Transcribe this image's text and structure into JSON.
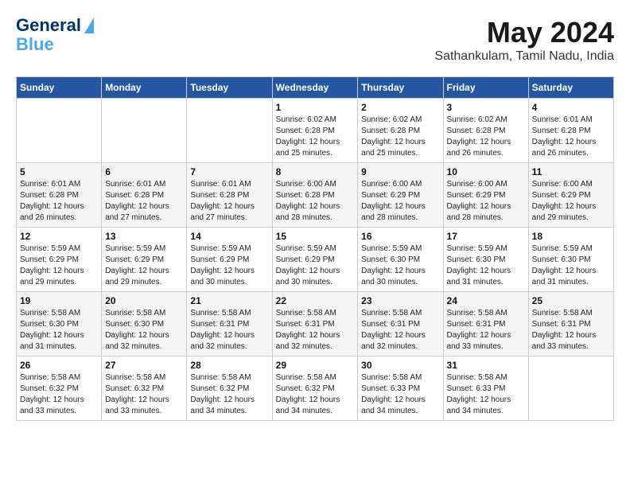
{
  "header": {
    "logo_line1": "General",
    "logo_line2": "Blue",
    "month_year": "May 2024",
    "location": "Sathankulam, Tamil Nadu, India"
  },
  "days_of_week": [
    "Sunday",
    "Monday",
    "Tuesday",
    "Wednesday",
    "Thursday",
    "Friday",
    "Saturday"
  ],
  "weeks": [
    [
      {
        "day": "",
        "info": ""
      },
      {
        "day": "",
        "info": ""
      },
      {
        "day": "",
        "info": ""
      },
      {
        "day": "1",
        "info": "Sunrise: 6:02 AM\nSunset: 6:28 PM\nDaylight: 12 hours\nand 25 minutes."
      },
      {
        "day": "2",
        "info": "Sunrise: 6:02 AM\nSunset: 6:28 PM\nDaylight: 12 hours\nand 25 minutes."
      },
      {
        "day": "3",
        "info": "Sunrise: 6:02 AM\nSunset: 6:28 PM\nDaylight: 12 hours\nand 26 minutes."
      },
      {
        "day": "4",
        "info": "Sunrise: 6:01 AM\nSunset: 6:28 PM\nDaylight: 12 hours\nand 26 minutes."
      }
    ],
    [
      {
        "day": "5",
        "info": "Sunrise: 6:01 AM\nSunset: 6:28 PM\nDaylight: 12 hours\nand 26 minutes."
      },
      {
        "day": "6",
        "info": "Sunrise: 6:01 AM\nSunset: 6:28 PM\nDaylight: 12 hours\nand 27 minutes."
      },
      {
        "day": "7",
        "info": "Sunrise: 6:01 AM\nSunset: 6:28 PM\nDaylight: 12 hours\nand 27 minutes."
      },
      {
        "day": "8",
        "info": "Sunrise: 6:00 AM\nSunset: 6:28 PM\nDaylight: 12 hours\nand 28 minutes."
      },
      {
        "day": "9",
        "info": "Sunrise: 6:00 AM\nSunset: 6:29 PM\nDaylight: 12 hours\nand 28 minutes."
      },
      {
        "day": "10",
        "info": "Sunrise: 6:00 AM\nSunset: 6:29 PM\nDaylight: 12 hours\nand 28 minutes."
      },
      {
        "day": "11",
        "info": "Sunrise: 6:00 AM\nSunset: 6:29 PM\nDaylight: 12 hours\nand 29 minutes."
      }
    ],
    [
      {
        "day": "12",
        "info": "Sunrise: 5:59 AM\nSunset: 6:29 PM\nDaylight: 12 hours\nand 29 minutes."
      },
      {
        "day": "13",
        "info": "Sunrise: 5:59 AM\nSunset: 6:29 PM\nDaylight: 12 hours\nand 29 minutes."
      },
      {
        "day": "14",
        "info": "Sunrise: 5:59 AM\nSunset: 6:29 PM\nDaylight: 12 hours\nand 30 minutes."
      },
      {
        "day": "15",
        "info": "Sunrise: 5:59 AM\nSunset: 6:29 PM\nDaylight: 12 hours\nand 30 minutes."
      },
      {
        "day": "16",
        "info": "Sunrise: 5:59 AM\nSunset: 6:30 PM\nDaylight: 12 hours\nand 30 minutes."
      },
      {
        "day": "17",
        "info": "Sunrise: 5:59 AM\nSunset: 6:30 PM\nDaylight: 12 hours\nand 31 minutes."
      },
      {
        "day": "18",
        "info": "Sunrise: 5:59 AM\nSunset: 6:30 PM\nDaylight: 12 hours\nand 31 minutes."
      }
    ],
    [
      {
        "day": "19",
        "info": "Sunrise: 5:58 AM\nSunset: 6:30 PM\nDaylight: 12 hours\nand 31 minutes."
      },
      {
        "day": "20",
        "info": "Sunrise: 5:58 AM\nSunset: 6:30 PM\nDaylight: 12 hours\nand 32 minutes."
      },
      {
        "day": "21",
        "info": "Sunrise: 5:58 AM\nSunset: 6:31 PM\nDaylight: 12 hours\nand 32 minutes."
      },
      {
        "day": "22",
        "info": "Sunrise: 5:58 AM\nSunset: 6:31 PM\nDaylight: 12 hours\nand 32 minutes."
      },
      {
        "day": "23",
        "info": "Sunrise: 5:58 AM\nSunset: 6:31 PM\nDaylight: 12 hours\nand 32 minutes."
      },
      {
        "day": "24",
        "info": "Sunrise: 5:58 AM\nSunset: 6:31 PM\nDaylight: 12 hours\nand 33 minutes."
      },
      {
        "day": "25",
        "info": "Sunrise: 5:58 AM\nSunset: 6:31 PM\nDaylight: 12 hours\nand 33 minutes."
      }
    ],
    [
      {
        "day": "26",
        "info": "Sunrise: 5:58 AM\nSunset: 6:32 PM\nDaylight: 12 hours\nand 33 minutes."
      },
      {
        "day": "27",
        "info": "Sunrise: 5:58 AM\nSunset: 6:32 PM\nDaylight: 12 hours\nand 33 minutes."
      },
      {
        "day": "28",
        "info": "Sunrise: 5:58 AM\nSunset: 6:32 PM\nDaylight: 12 hours\nand 34 minutes."
      },
      {
        "day": "29",
        "info": "Sunrise: 5:58 AM\nSunset: 6:32 PM\nDaylight: 12 hours\nand 34 minutes."
      },
      {
        "day": "30",
        "info": "Sunrise: 5:58 AM\nSunset: 6:33 PM\nDaylight: 12 hours\nand 34 minutes."
      },
      {
        "day": "31",
        "info": "Sunrise: 5:58 AM\nSunset: 6:33 PM\nDaylight: 12 hours\nand 34 minutes."
      },
      {
        "day": "",
        "info": ""
      }
    ]
  ]
}
